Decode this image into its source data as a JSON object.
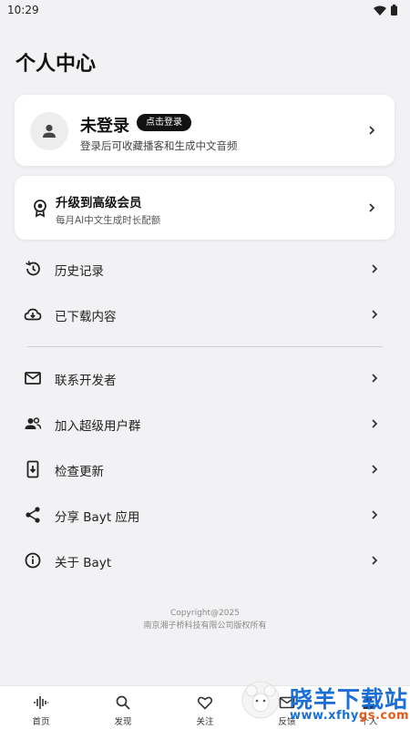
{
  "status_bar": {
    "time": "10:29",
    "wifi_icon": "wifi-icon",
    "battery_icon": "battery-icon"
  },
  "page": {
    "title": "个人中心"
  },
  "login_card": {
    "name": "未登录",
    "login_button": "点击登录",
    "description": "登录后可收藏播客和生成中文音频",
    "avatar_icon": "person-icon"
  },
  "vip_card": {
    "title": "升级到高级会员",
    "description": "每月AI中文生成时长配额",
    "icon": "award-badge-icon"
  },
  "menu": {
    "group1": [
      {
        "label": "历史记录",
        "icon": "history-icon"
      },
      {
        "label": "已下载内容",
        "icon": "cloud-download-icon"
      }
    ],
    "group2": [
      {
        "label": "联系开发者",
        "icon": "mail-icon"
      },
      {
        "label": "加入超级用户群",
        "icon": "group-icon"
      },
      {
        "label": "检查更新",
        "icon": "phone-update-icon"
      },
      {
        "label": "分享 Bayt 应用",
        "icon": "share-icon"
      },
      {
        "label": "关于 Bayt",
        "icon": "info-icon"
      }
    ]
  },
  "footer": {
    "copyright": "Copyright@2025",
    "company": "南京湘子桥科技有限公司版权所有"
  },
  "bottom_nav": [
    {
      "label": "首页",
      "icon": "waveform-icon"
    },
    {
      "label": "发现",
      "icon": "search-icon"
    },
    {
      "label": "关注",
      "icon": "heart-icon"
    },
    {
      "label": "反馈",
      "icon": "mail-icon"
    },
    {
      "label": "个人",
      "icon": "person-icon"
    }
  ],
  "watermark": {
    "title": "晓羊下载站",
    "url": "www.xfhy",
    "url_tld": "gs.com"
  },
  "colors": {
    "background": "#f2f2f4",
    "card": "#ffffff",
    "primary_text": "#111111",
    "watermark_blue": "#1a6fd6",
    "watermark_orange": "#e85a1c"
  }
}
